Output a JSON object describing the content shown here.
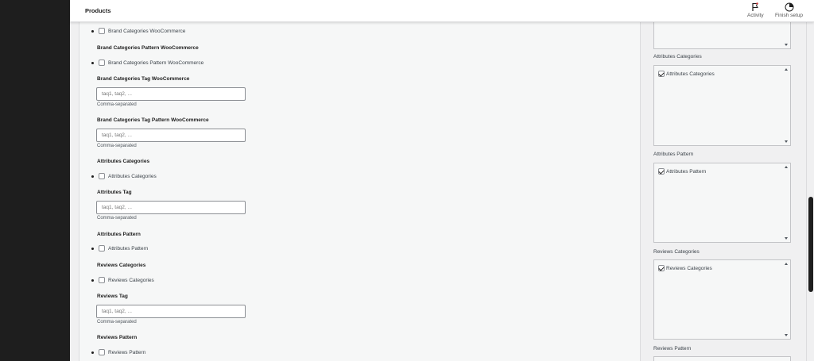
{
  "header": {
    "title": "Products",
    "activity_label": "Activity",
    "finish_setup_label": "Finish setup"
  },
  "main": {
    "brand_categories_cb": "Brand Categories WooCommerce",
    "brand_categories_pattern_heading": "Brand Categories Pattern WooCommerce",
    "brand_categories_pattern_cb": "Brand Categories Pattern WooCommerce",
    "brand_categories_tag_heading": "Brand Categories Tag WooCommerce",
    "brand_categories_tag_placeholder": "taq1, taq2, ...",
    "brand_categories_tag_help": "Comma-separated",
    "brand_categories_tag_pattern_heading": "Brand Categories Tag Pattern WooCommerce",
    "brand_categories_tag_pattern_placeholder": "taq1, taq2, ...",
    "brand_categories_tag_pattern_help": "Comma-separated",
    "attributes_categories_heading": "Attributes Categories",
    "attributes_categories_cb": "Attributes Categories",
    "attributes_tag_heading": "Attributes Tag",
    "attributes_tag_placeholder": "taq1, taq2, ...",
    "attributes_tag_help": "Comma-separated",
    "attributes_pattern_heading": "Attributes Pattern",
    "attributes_pattern_cb": "Attributes Pattern",
    "reviews_categories_heading": "Reviews Categories",
    "reviews_categories_cb": "Reviews Categories",
    "reviews_tag_heading": "Reviews Tag",
    "reviews_tag_placeholder": "taq1, taq2, ...",
    "reviews_tag_help": "Comma-separated",
    "reviews_pattern_heading": "Reviews Pattern",
    "reviews_pattern_cb": "Reviews Pattern"
  },
  "sidebar": {
    "attributes_categories_label": "Attributes Categories",
    "attributes_categories_item": "Attributes Categories",
    "attributes_pattern_label": "Attributes Pattern",
    "attributes_pattern_item": "Attributes Pattern",
    "reviews_categories_label": "Reviews Categories",
    "reviews_categories_item": "Reviews Categories",
    "reviews_pattern_label": "Reviews Pattern"
  },
  "icons": {
    "activity": "flag-icon",
    "finish_setup": "progress-circle-icon"
  },
  "colors": {
    "admin_dark": "#1e1e1e",
    "page_bg": "#f0f0f1",
    "border": "#c3c4c7"
  }
}
